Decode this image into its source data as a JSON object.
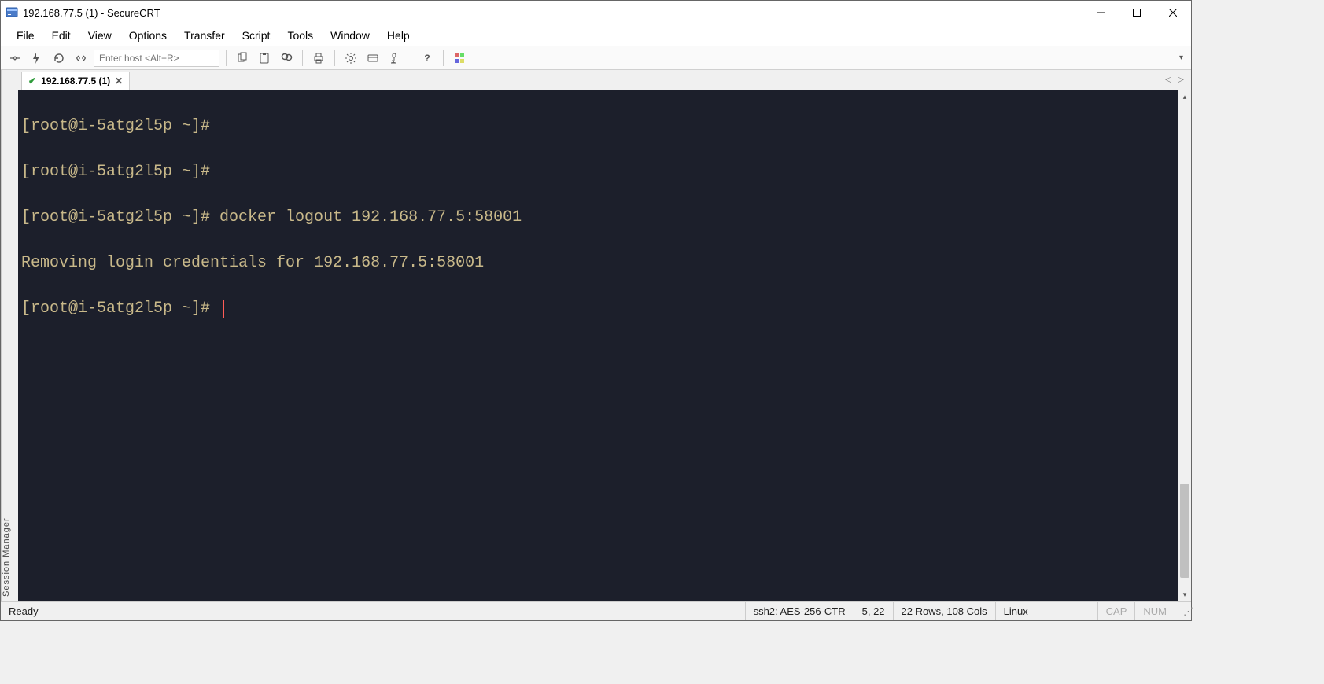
{
  "titlebar": {
    "title": "192.168.77.5 (1) - SecureCRT"
  },
  "menubar": {
    "items": [
      "File",
      "Edit",
      "View",
      "Options",
      "Transfer",
      "Script",
      "Tools",
      "Window",
      "Help"
    ]
  },
  "toolbar": {
    "host_placeholder": "Enter host <Alt+R>"
  },
  "session_manager_label": "Session Manager",
  "tabs": {
    "active": {
      "label": "192.168.77.5 (1)"
    }
  },
  "terminal": {
    "lines": [
      "[root@i-5atg2l5p ~]#",
      "[root@i-5atg2l5p ~]#",
      "[root@i-5atg2l5p ~]# docker logout 192.168.77.5:58001",
      "Removing login credentials for 192.168.77.5:58001",
      "[root@i-5atg2l5p ~]# "
    ]
  },
  "statusbar": {
    "ready": "Ready",
    "cipher": "ssh2: AES-256-CTR",
    "cursor": "5,  22",
    "dims": "22 Rows, 108 Cols",
    "os": "Linux",
    "cap": "CAP",
    "num": "NUM"
  }
}
